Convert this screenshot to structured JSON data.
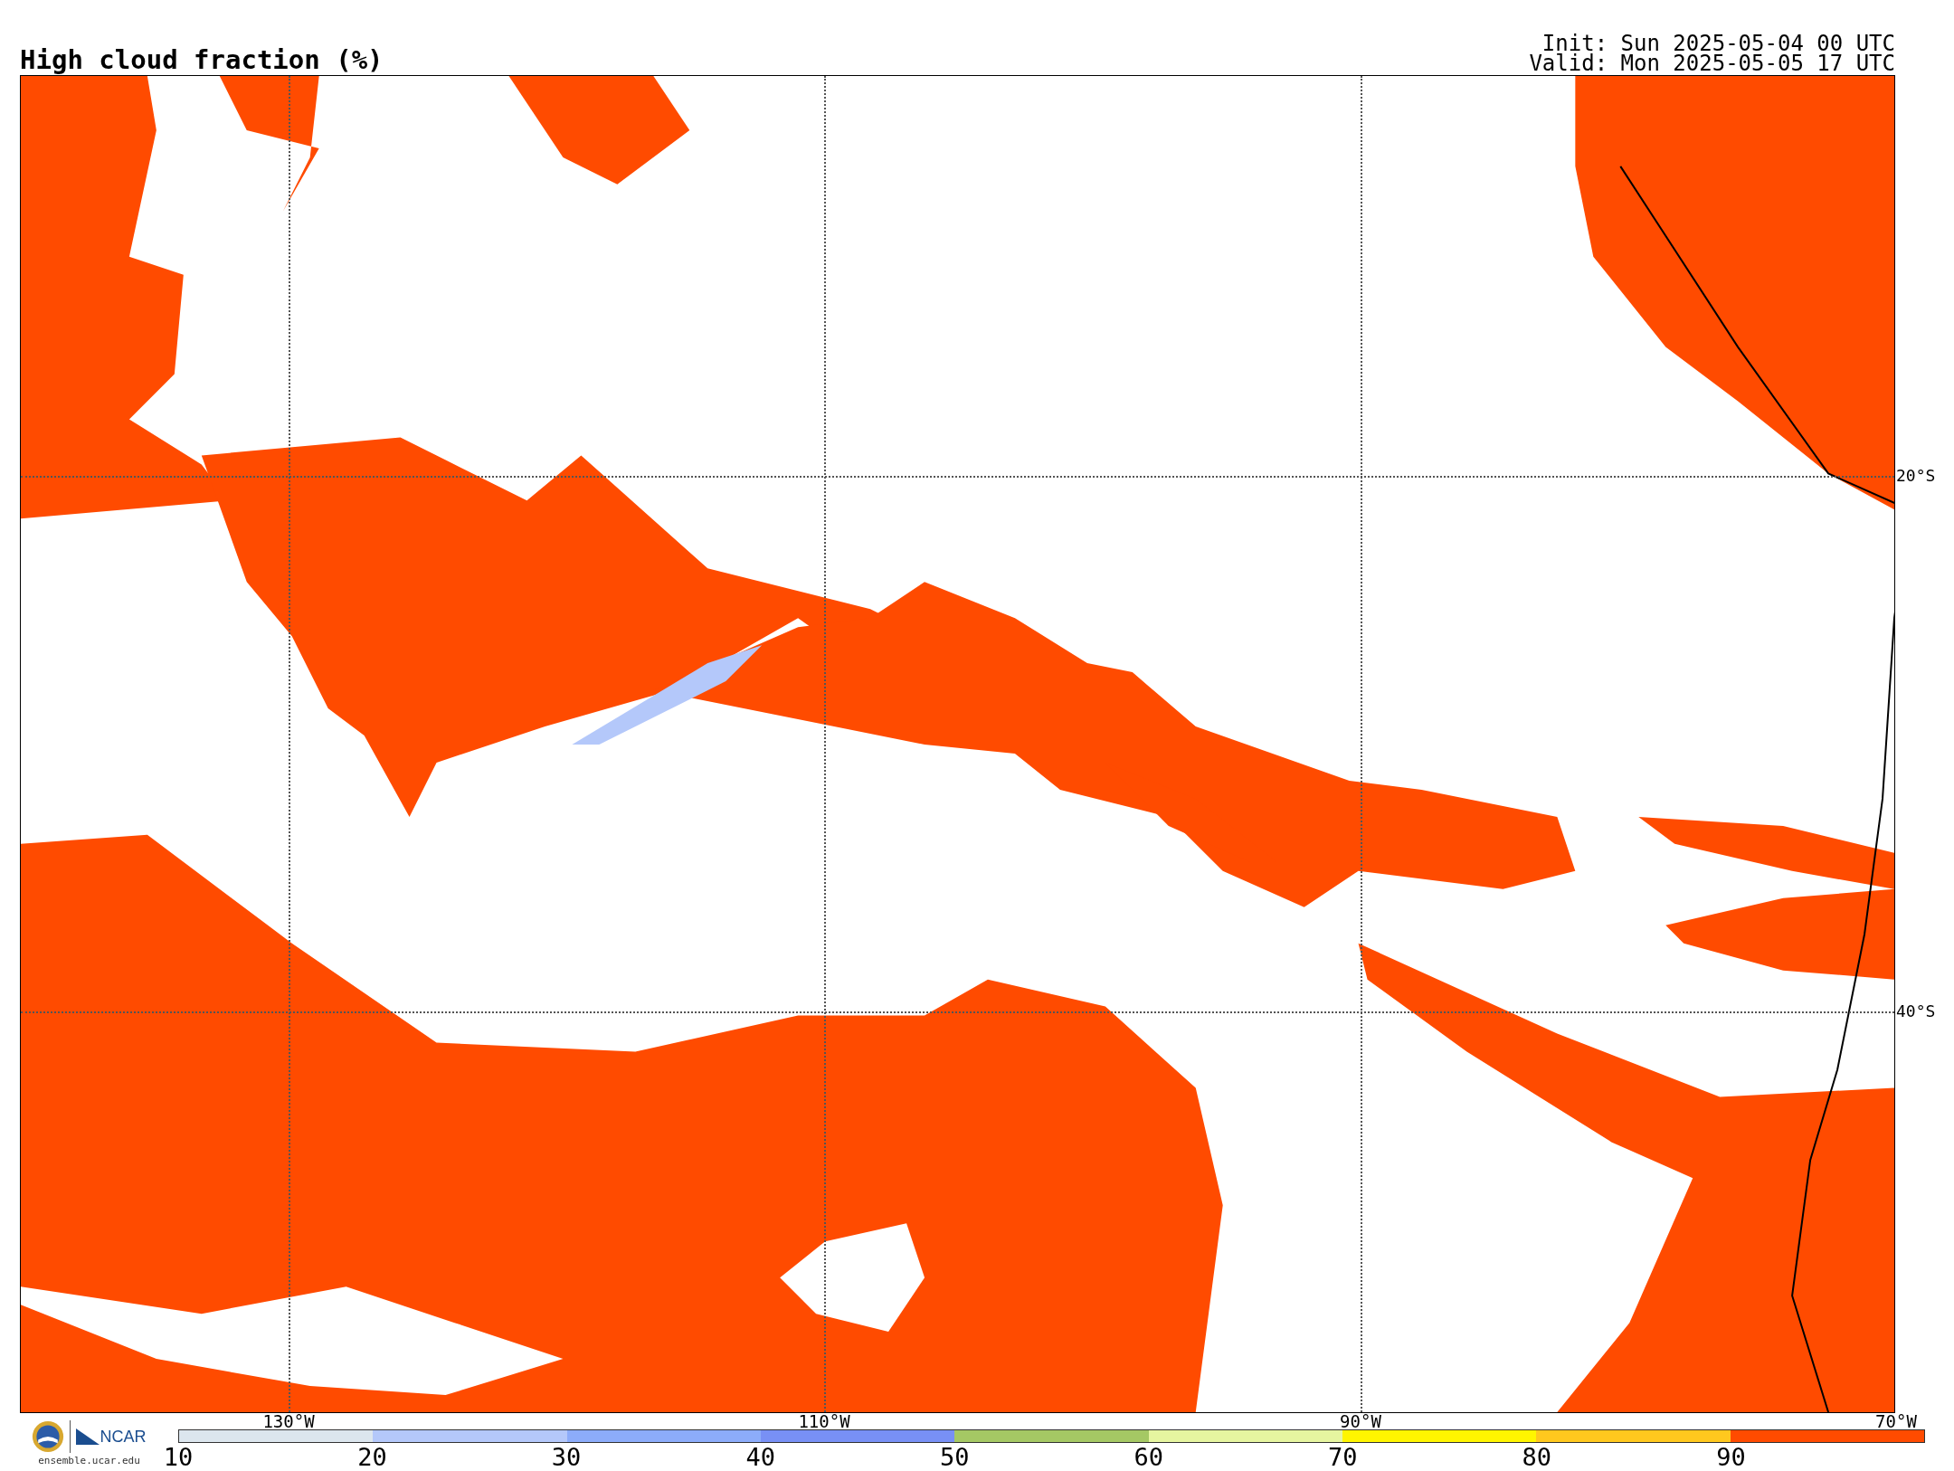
{
  "title": "High cloud fraction (%)",
  "run_info": [
    "Init: Sun 2025-05-04 00 UTC",
    "Valid: Mon 2025-05-05 17 UTC"
  ],
  "map": {
    "latitude_labels": [
      "20°S",
      "40°S"
    ],
    "longitude_labels": [
      "130°W",
      "110°W",
      "90°W",
      "70°W"
    ]
  },
  "logo": {
    "name": "NCAR",
    "url": "ensemble.ucar.edu"
  },
  "colorbar": {
    "bins": [
      {
        "color": "#dce6ee"
      },
      {
        "color": "#b4c8fa"
      },
      {
        "color": "#8cacfa"
      },
      {
        "color": "#7890f5"
      },
      {
        "color": "#a5c864"
      },
      {
        "color": "#e6f5a0"
      },
      {
        "color": "#fff500"
      },
      {
        "color": "#ffc81e"
      },
      {
        "color": "#ff4b00"
      }
    ],
    "ticks": [
      "10",
      "20",
      "30",
      "40",
      "50",
      "60",
      "70",
      "80",
      "90"
    ]
  }
}
